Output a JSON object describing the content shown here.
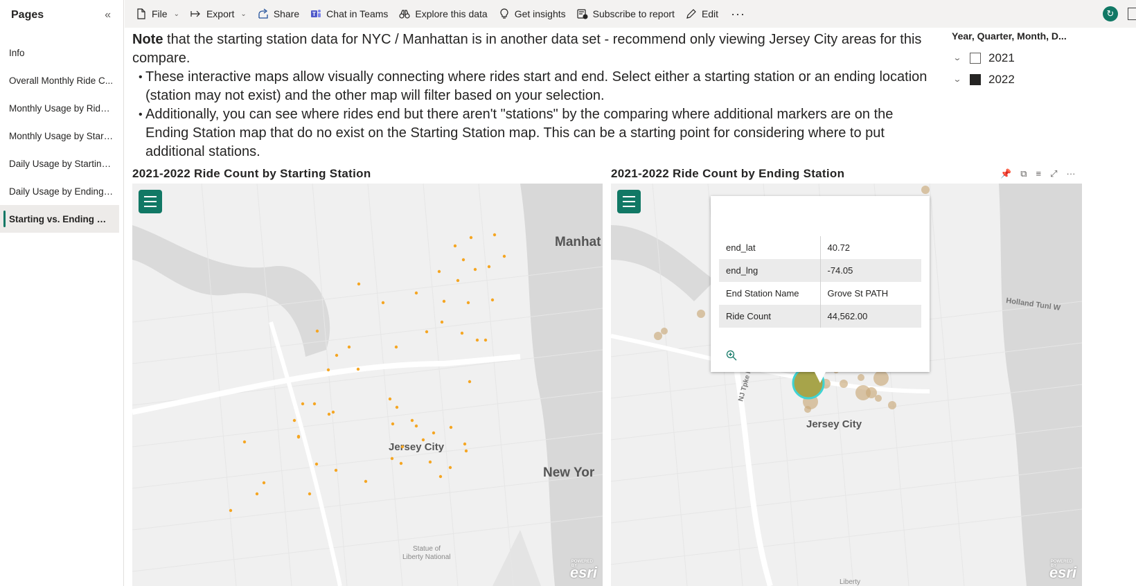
{
  "sidebar": {
    "title": "Pages",
    "collapse_icon": "double-chevron-left-icon",
    "items": [
      {
        "label": "Info"
      },
      {
        "label": "Overall Monthly Ride C..."
      },
      {
        "label": "Monthly Usage by Rider..."
      },
      {
        "label": "Monthly Usage by Starti..."
      },
      {
        "label": "Daily Usage by Starting ..."
      },
      {
        "label": "Daily Usage by Ending S..."
      },
      {
        "label": "Starting vs. Ending Stat..."
      }
    ],
    "active_index": 6
  },
  "toolbar": {
    "file": "File",
    "export": "Export",
    "share": "Share",
    "chat": "Chat in Teams",
    "explore": "Explore this data",
    "insights": "Get insights",
    "subscribe": "Subscribe to report",
    "edit": "Edit",
    "more": "···"
  },
  "note": {
    "bold": "Note",
    "text": " that the starting station data for NYC / Manhattan is in another data set - recommend only viewing Jersey City areas for this compare.",
    "bullets": [
      "These interactive maps allow visually connecting where rides start and end. Select either a starting station or an ending location (station may not exist) and the other map will filter based on your selection.",
      "Additionally, you can see where rides end but there aren't \"stations\" by the comparing where additional markers are on the Ending Station map that do no exist on the Starting Station map. This can be a starting point for considering where to put additional stations."
    ]
  },
  "slicer": {
    "title": "Year, Quarter, Month, D...",
    "options": [
      {
        "label": "2021",
        "checked": false
      },
      {
        "label": "2022",
        "checked": true
      }
    ]
  },
  "map_left": {
    "title": "2021-2022 Ride Count by Starting Station",
    "labels": {
      "city": "Jersey City",
      "manhattan": "Manhat",
      "newyork": "New Yor",
      "liberty": "Statue of\nLiberty National"
    },
    "marker_color": "#f5a623",
    "attribution": "esri"
  },
  "map_right": {
    "title": "2021-2022 Ride Count by Ending Station",
    "labels": {
      "city": "Jersey City",
      "holland": "Holland Tunl W",
      "tpke": "NJ Tpke N",
      "liberty": "Liberty"
    },
    "bubble_color": "#c9a97a",
    "selected_color": "#a7a44a",
    "attribution": "esri"
  },
  "tooltip": {
    "rows": [
      {
        "key": "end_lat",
        "value": "40.72"
      },
      {
        "key": "end_lng",
        "value": "-74.05"
      },
      {
        "key": "End Station Name",
        "value": "Grove St PATH"
      },
      {
        "key": "Ride Count",
        "value": "44,562.00"
      }
    ]
  },
  "accent_color": "#117865"
}
